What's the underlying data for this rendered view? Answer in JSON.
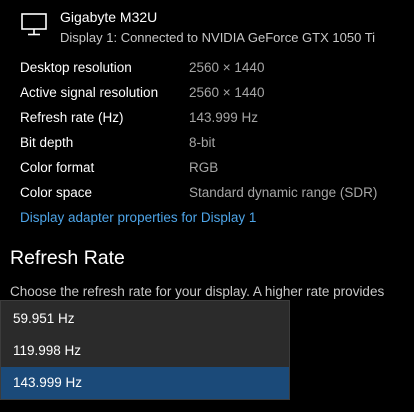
{
  "monitor": {
    "icon": "monitor-icon",
    "name": "Gigabyte M32U",
    "subtitle": "Display 1: Connected to NVIDIA GeForce GTX 1050 Ti"
  },
  "properties": [
    {
      "label": "Desktop resolution",
      "value": "2560 × 1440"
    },
    {
      "label": "Active signal resolution",
      "value": "2560 × 1440"
    },
    {
      "label": "Refresh rate (Hz)",
      "value": "143.999 Hz"
    },
    {
      "label": "Bit depth",
      "value": "8-bit"
    },
    {
      "label": "Color format",
      "value": "RGB"
    },
    {
      "label": "Color space",
      "value": "Standard dynamic range (SDR)"
    }
  ],
  "adapter_link": "Display adapter properties for Display 1",
  "refresh_section": {
    "title": "Refresh Rate",
    "description": "Choose the refresh rate for your display. A higher rate provides"
  },
  "dropdown": {
    "options": [
      "59.951 Hz",
      "119.998 Hz",
      "143.999 Hz"
    ],
    "selected_index": 2
  },
  "colors": {
    "background": "#000000",
    "link": "#4ea5e8",
    "selected_option": "#1b4a79",
    "dropdown_bg": "#2b2b2b"
  }
}
